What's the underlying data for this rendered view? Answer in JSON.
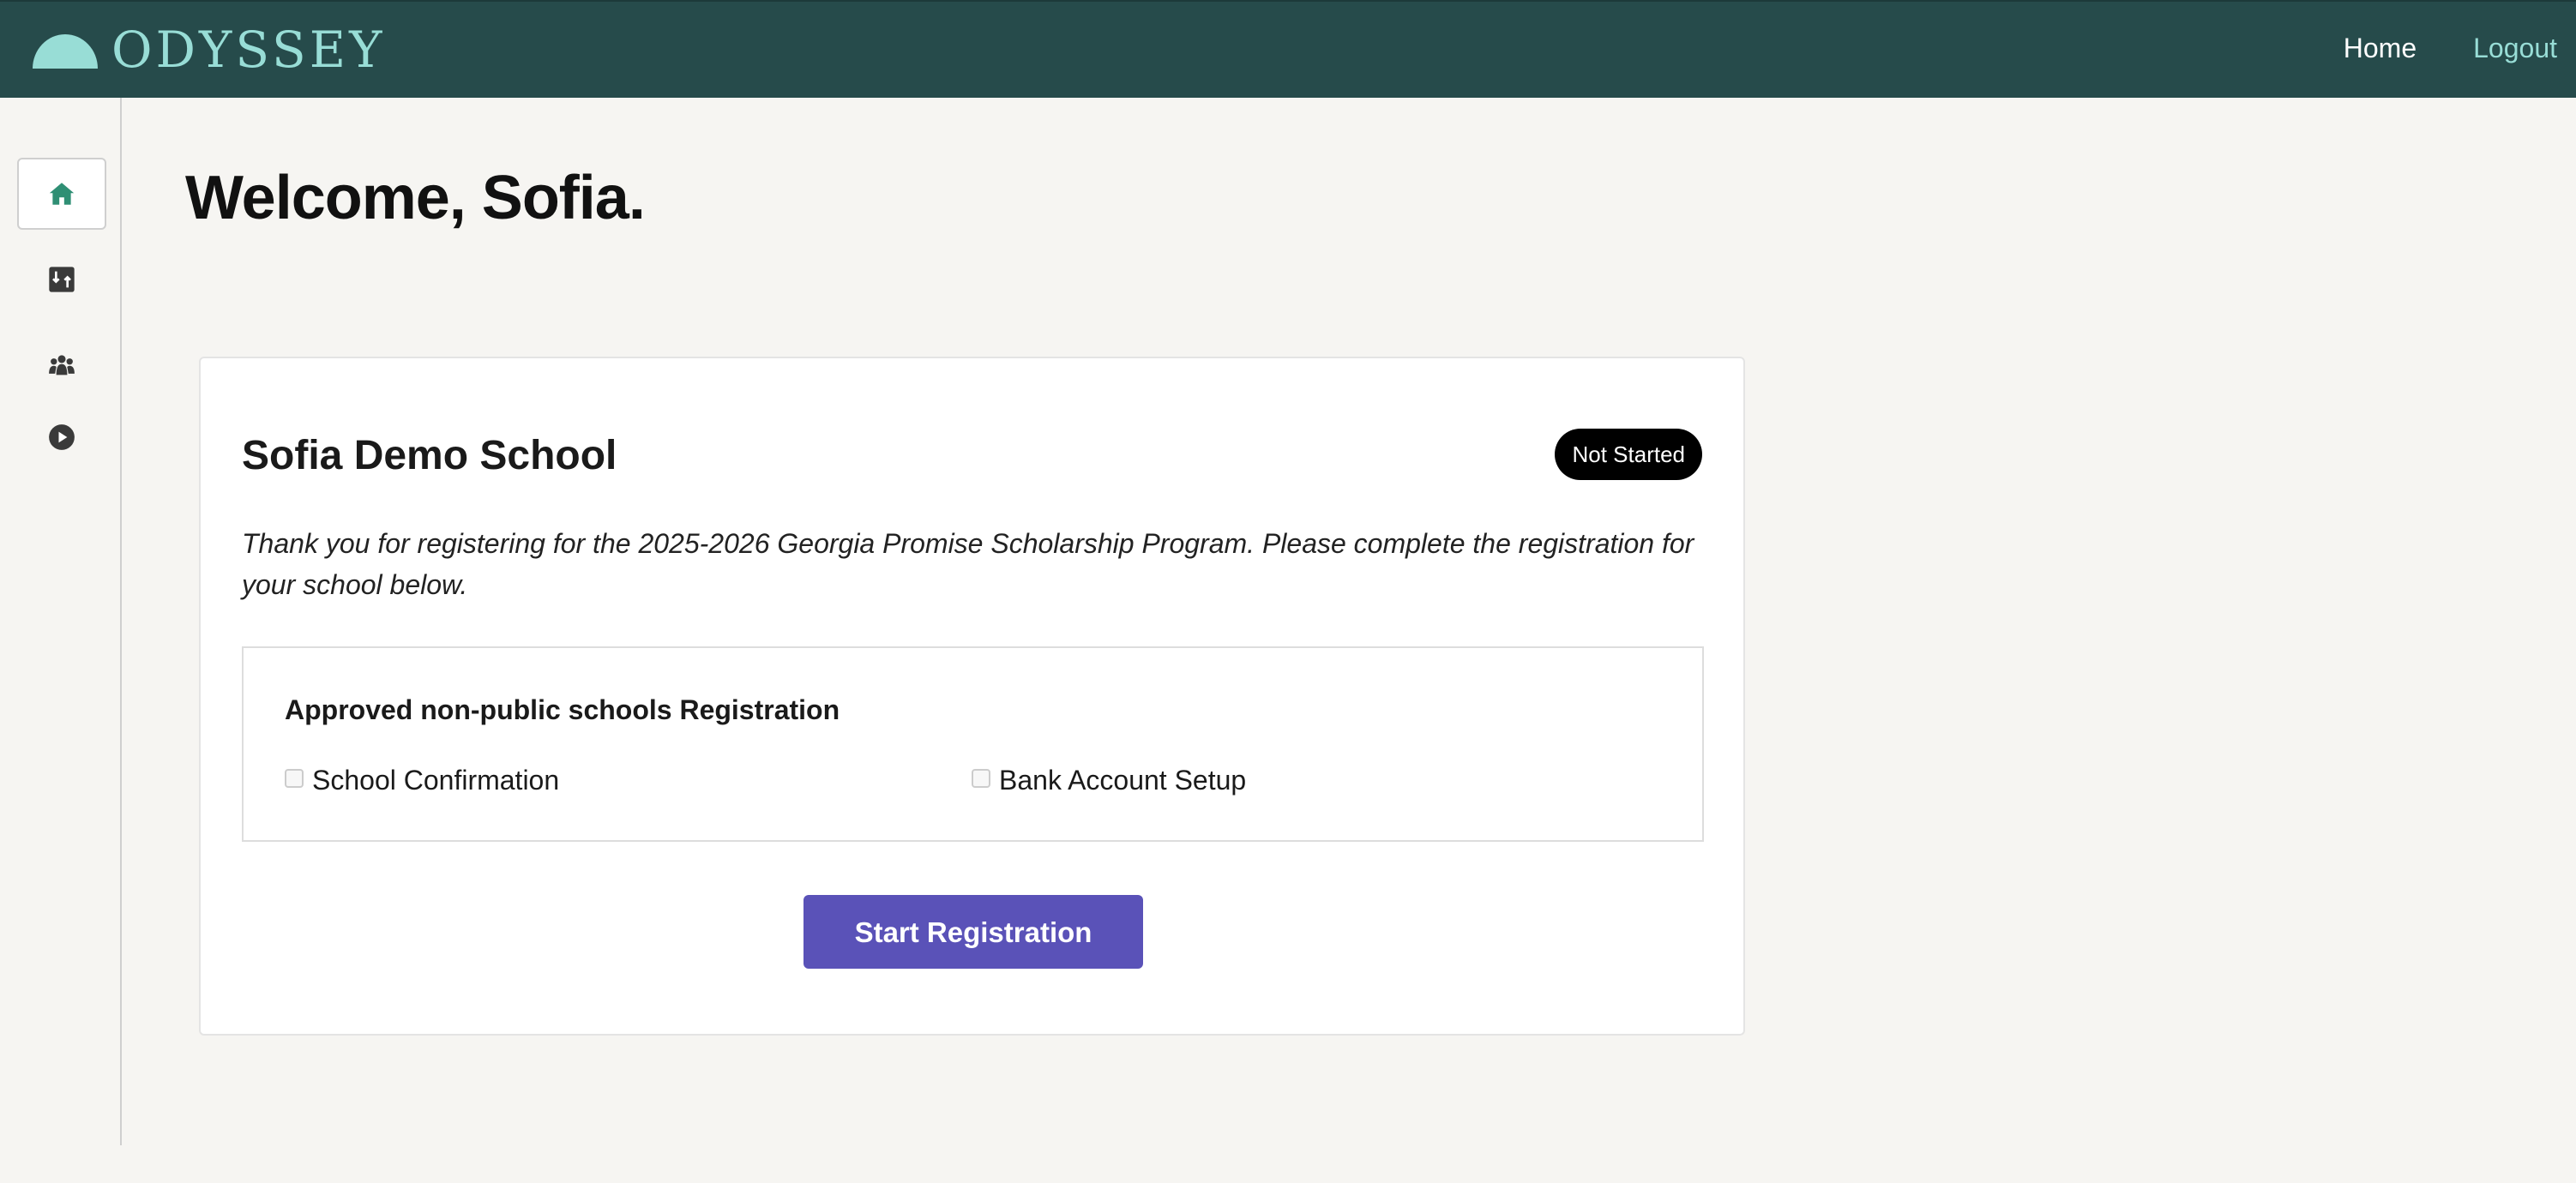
{
  "header": {
    "brand": "ODYSSEY",
    "logo_icon": "half-circle-logo-icon",
    "nav": {
      "home": "Home",
      "logout": "Logout"
    }
  },
  "sidebar": {
    "items": [
      {
        "icon": "home-icon",
        "active": true
      },
      {
        "icon": "transactions-icon",
        "active": false
      },
      {
        "icon": "users-icon",
        "active": false
      },
      {
        "icon": "play-circle-icon",
        "active": false
      }
    ]
  },
  "main": {
    "welcome": "Welcome, Sofia.",
    "card": {
      "school_name": "Sofia Demo School",
      "status": "Not Started",
      "intro": "Thank you for registering for the 2025-2026 Georgia Promise Scholarship Program. Please complete the registration for your school below.",
      "registration": {
        "title": "Approved non-public schools Registration",
        "steps": [
          {
            "label": "School Confirmation",
            "checked": false
          },
          {
            "label": "Bank Account Setup",
            "checked": false
          }
        ]
      },
      "cta": "Start Registration"
    }
  },
  "colors": {
    "header_bg": "#264b4b",
    "brand_accent": "#98ddd6",
    "page_bg": "#f6f5f2",
    "primary_button": "#5a52b8",
    "status_badge_bg": "#000000",
    "active_icon": "#2f8f74",
    "sidebar_icon": "#3a3a3a"
  }
}
